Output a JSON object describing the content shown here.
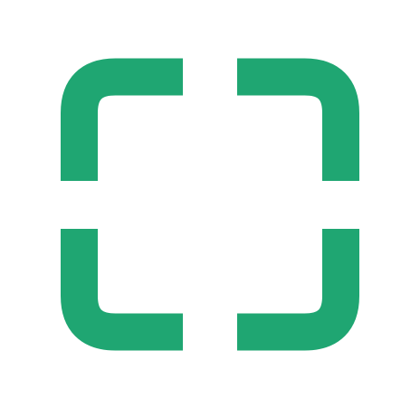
{
  "icon": {
    "name": "scan-frame-icon",
    "color": "#1fa672"
  },
  "background_color": "#ffffff"
}
